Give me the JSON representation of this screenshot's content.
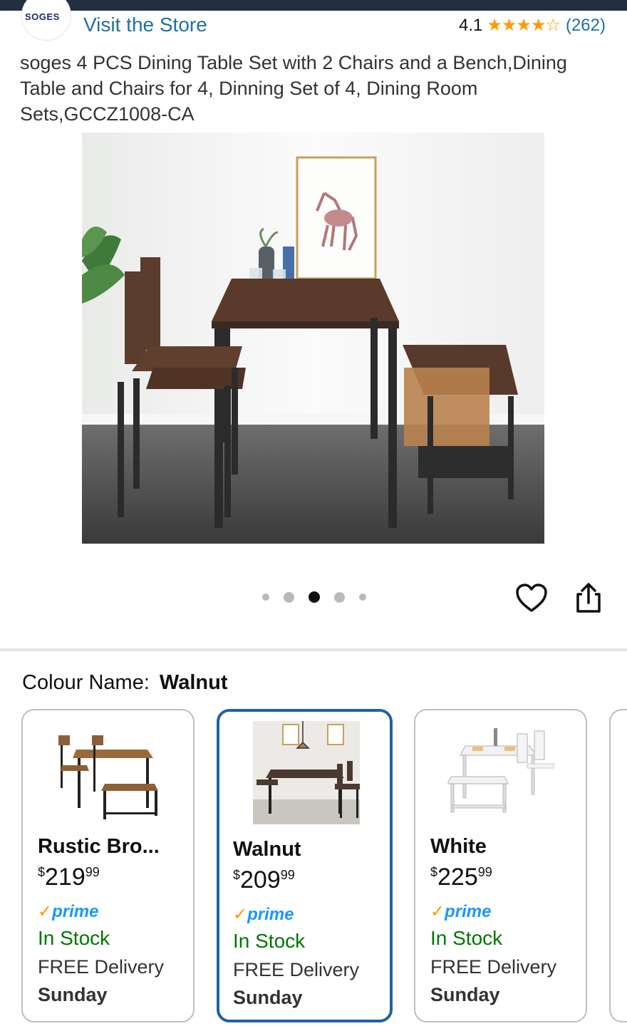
{
  "store": {
    "logo_text": "SOGES",
    "visit_label": "Visit the Store",
    "rating_value": "4.1",
    "rating_stars": "★★★★☆",
    "rating_count": "(262)"
  },
  "product": {
    "title": "soges 4 PCS Dining Table Set with 2 Chairs and a Bench,Dining Table and Chairs for 4, Dinning Set of 4, Dining Room Sets,GCCZ1008-CA"
  },
  "gallery": {
    "image_count": 5,
    "active_index": 3
  },
  "colour": {
    "label": "Colour Name:",
    "selected": "Walnut"
  },
  "swatches": [
    {
      "name": "Rustic Bro...",
      "price_currency": "$",
      "price_whole": "219",
      "price_fraction": "99",
      "prime_check": "✓",
      "prime": "prime",
      "stock": "In Stock",
      "delivery": "FREE Delivery",
      "day": "Sunday"
    },
    {
      "name": "Walnut",
      "price_currency": "$",
      "price_whole": "209",
      "price_fraction": "99",
      "prime_check": "✓",
      "prime": "prime",
      "stock": "In Stock",
      "delivery": "FREE Delivery",
      "day": "Sunday"
    },
    {
      "name": "White",
      "price_currency": "$",
      "price_whole": "225",
      "price_fraction": "99",
      "prime_check": "✓",
      "prime": "prime",
      "stock": "In Stock",
      "delivery": "FREE Delivery",
      "day": "Sunday"
    }
  ],
  "colors": {
    "link": "#1f6fa6",
    "star": "#ff9900",
    "prime": "#1a98ff",
    "in_stock": "#007600",
    "selected_border": "#2162a1"
  },
  "icons": {
    "wishlist": "heart-icon",
    "share": "share-icon"
  }
}
